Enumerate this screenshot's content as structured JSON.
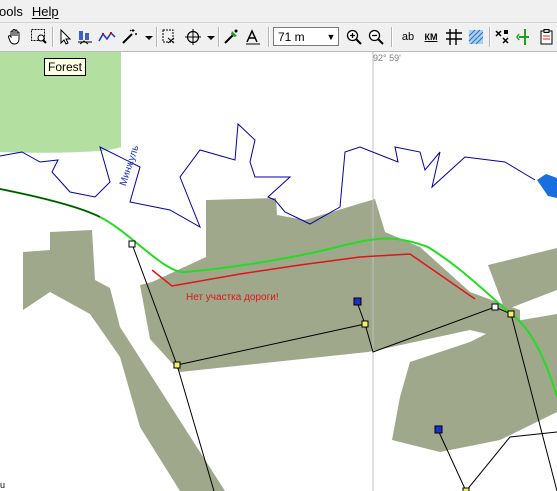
{
  "menu": {
    "items": [
      "ools",
      "Help"
    ]
  },
  "toolbar": {
    "scale_value": "71 m",
    "buttons": [
      "hand-icon",
      "zoom-rect-icon",
      "pointer-icon",
      "route-icon",
      "track-icon",
      "magic-wand-icon",
      "crop-icon",
      "target-icon",
      "gps-icon",
      "label-icon",
      "zoom-in-icon",
      "zoom-out-icon",
      "ab-icon",
      "km-icon",
      "grid-icon",
      "hatch-icon",
      "waypoint-icon",
      "arrow-icon",
      "clipboard-icon"
    ],
    "text_buttons": {
      "ab": "ab",
      "km": "КМ"
    }
  },
  "map": {
    "coordinate_label": "92° 59'",
    "tooltip": "Forest",
    "river_name": "Минжуль",
    "missing_road_note": "Нет участка дороги!",
    "corner_text": "u",
    "colors": {
      "forest": "#b3e0a0",
      "area": "#a0a88c",
      "river": "#0000aa",
      "track": "#22dd22",
      "warning": "#e0141c",
      "road": "#000000",
      "vertex_square": "#f3f06a",
      "marker": "#1a2fd0"
    }
  }
}
